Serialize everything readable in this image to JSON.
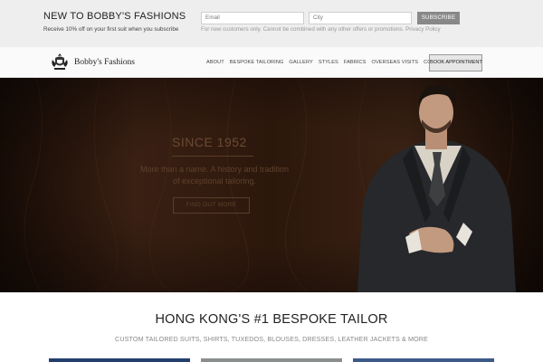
{
  "promo": {
    "title": "NEW TO BOBBY'S FASHIONS",
    "subtitle": "Receive 10% off on your first suit when you subscribe",
    "email_placeholder": "Email",
    "city_placeholder": "City",
    "subscribe_label": "SUBSCRIBE",
    "note": "For new customers only. Cannot be combined with any other offers or promotions. Privacy Policy"
  },
  "nav": {
    "logo_text": "Bobby's Fashions",
    "items": [
      "ABOUT",
      "BESPOKE TAILORING",
      "GALLERY",
      "STYLES",
      "FABRICS",
      "OVERSEAS VISITS",
      "CONTACT"
    ],
    "book_label": "BOOK APPOINTMENT"
  },
  "hero": {
    "since": "SINCE 1952",
    "tagline_1": "More than a name. A history and tradition",
    "tagline_2": "of exceptional tailoring.",
    "cta_label": "FIND OUT MORE"
  },
  "section": {
    "title": "HONG KONG'S #1 BESPOKE TAILOR",
    "subtitle": "CUSTOM TAILORED SUITS, SHIRTS, TUXEDOS, BLOUSES, DRESSES, LEATHER JACKETS & MORE"
  },
  "colors": {
    "promo_bg": "#eeeeee",
    "subscribe_bg": "#888888",
    "hero_bg": "#2a160c"
  }
}
